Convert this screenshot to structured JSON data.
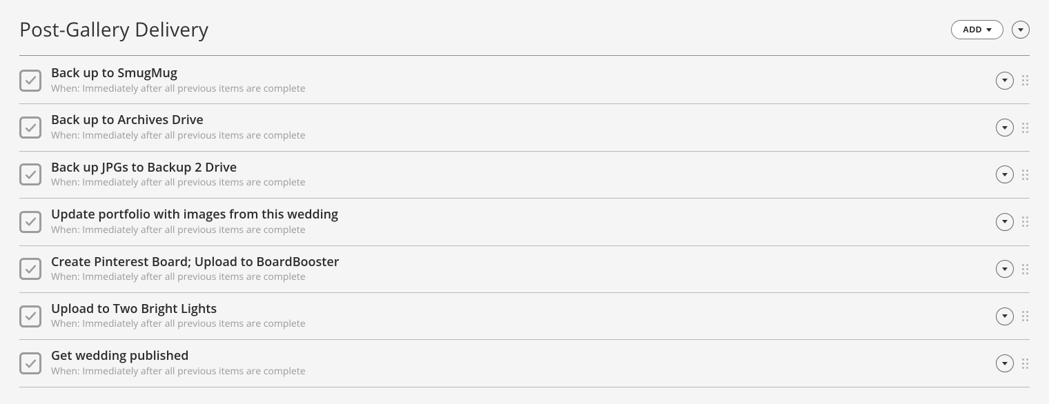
{
  "section": {
    "title": "Post-Gallery Delivery",
    "add_label": "ADD"
  },
  "tasks": [
    {
      "title": "Back up to SmugMug",
      "when": "When: Immediately after all previous items are complete"
    },
    {
      "title": "Back up to Archives Drive",
      "when": "When: Immediately after all previous items are complete"
    },
    {
      "title": "Back up JPGs to Backup 2 Drive",
      "when": "When: Immediately after all previous items are complete"
    },
    {
      "title": "Update portfolio with images from this wedding",
      "when": "When: Immediately after all previous items are complete"
    },
    {
      "title": "Create Pinterest Board; Upload to BoardBooster",
      "when": "When: Immediately after all previous items are complete"
    },
    {
      "title": "Upload to Two Bright Lights",
      "when": "When: Immediately after all previous items are complete"
    },
    {
      "title": "Get wedding published",
      "when": "When: Immediately after all previous items are complete"
    }
  ]
}
